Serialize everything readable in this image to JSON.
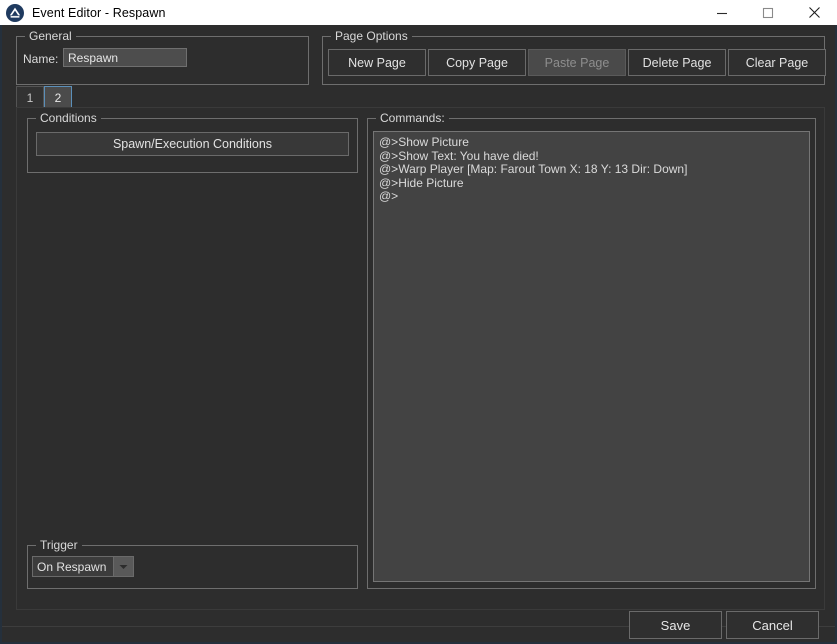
{
  "window": {
    "title": "Event Editor - Respawn",
    "icon": "app-logo-icon",
    "minimize_label": "–",
    "maximize_label": "□",
    "close_label": "✕"
  },
  "general": {
    "group_label": "General",
    "name_label": "Name:",
    "name_value": "Respawn",
    "name_placeholder": ""
  },
  "page_options": {
    "group_label": "Page Options",
    "buttons": [
      {
        "label": "New Page",
        "enabled": true
      },
      {
        "label": "Copy Page",
        "enabled": true
      },
      {
        "label": "Paste Page",
        "enabled": false
      },
      {
        "label": "Delete Page",
        "enabled": true
      },
      {
        "label": "Clear Page",
        "enabled": true
      }
    ]
  },
  "tabs": {
    "items": [
      {
        "label": "1",
        "active": false
      },
      {
        "label": "2",
        "active": true
      }
    ],
    "active_index": 1
  },
  "conditions": {
    "group_label": "Conditions",
    "button_label": "Spawn/Execution Conditions"
  },
  "trigger": {
    "group_label": "Trigger",
    "selected": "On Respawn",
    "arrow_icon": "chevron-down-icon"
  },
  "commands": {
    "group_label": "Commands:",
    "lines": [
      "@>Show Picture",
      "@>Show Text: You have died!",
      "@>Warp Player [Map: Farout Town X: 18 Y: 13 Dir: Down]",
      "@>Hide Picture",
      "@>"
    ]
  },
  "dialog_buttons": {
    "save_label": "Save",
    "cancel_label": "Cancel"
  },
  "colors": {
    "window_bg": "#2d2d2d",
    "titlebar_bg": "#ffffff",
    "titlebar_text": "#000000",
    "group_border": "#6e6e6e",
    "text": "#e2e2e2",
    "list_bg": "#434343",
    "tab_active_border": "#5b8fb9",
    "disabled_bg": "#4a4a4a",
    "disabled_text": "#8e8e8e"
  }
}
